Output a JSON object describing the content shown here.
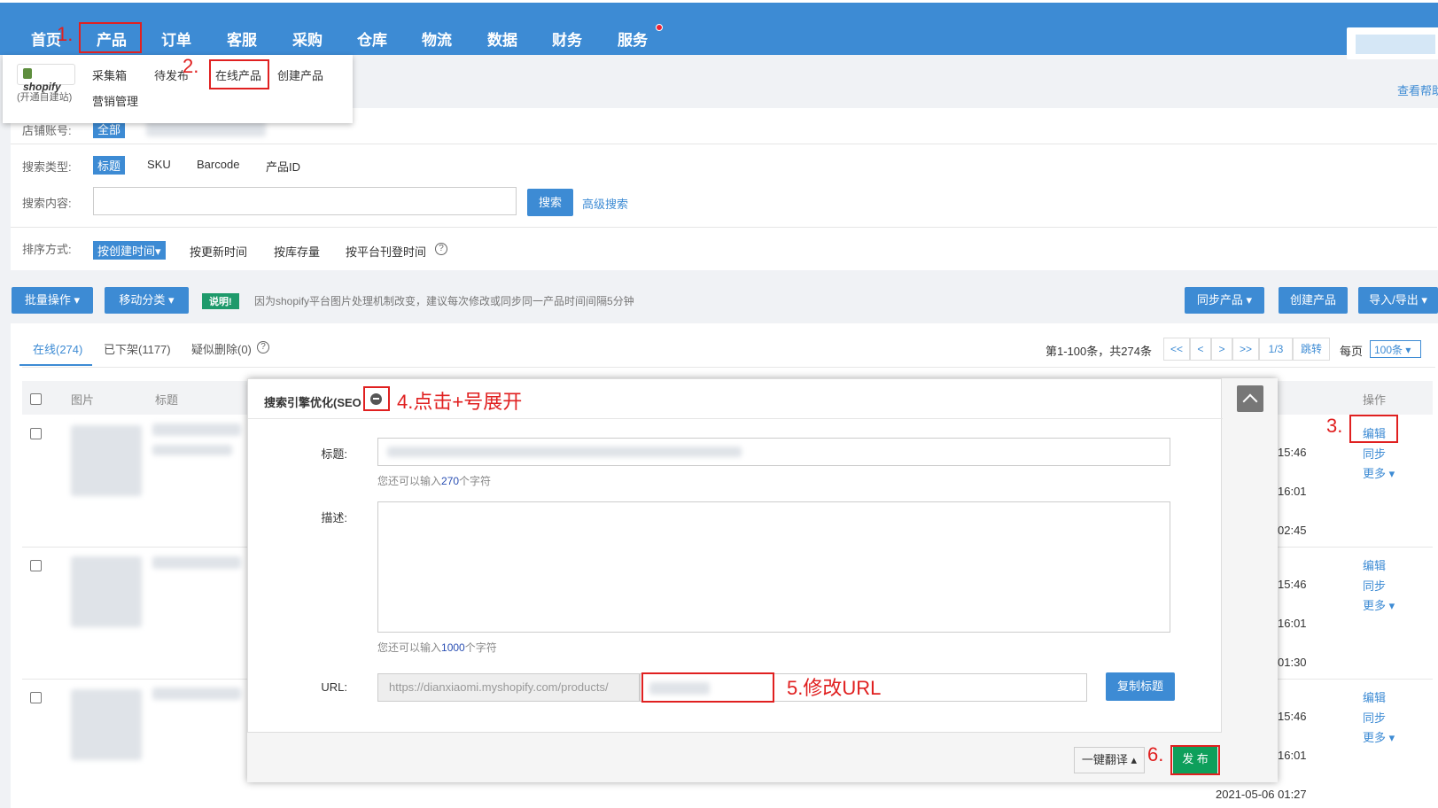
{
  "nav": {
    "items": [
      "首页",
      "产品",
      "订单",
      "客服",
      "采购",
      "仓库",
      "物流",
      "数据",
      "财务",
      "服务"
    ]
  },
  "dropdown": {
    "shopify_logo_text": "shopify",
    "shopify_sub": "(开通自建站)",
    "items": [
      "采集箱",
      "待发布",
      "在线产品",
      "创建产品",
      "营销管理"
    ]
  },
  "annotations": {
    "a1": "1.",
    "a2": "2.",
    "a3": "3.",
    "a4": "4.点击+号展开",
    "a5": "5.修改URL",
    "a6": "6."
  },
  "help_link": "查看帮助",
  "filters": {
    "shop_label": "店铺账号:",
    "shop_all": "全部",
    "search_type_label": "搜索类型:",
    "search_types": [
      "标题",
      "SKU",
      "Barcode",
      "产品ID"
    ],
    "search_content_label": "搜索内容:",
    "search_button": "搜索",
    "advanced_search": "高级搜索",
    "sort_label": "排序方式:",
    "sort_options": [
      "按创建时间▾",
      "按更新时间",
      "按库存量",
      "按平台刊登时间"
    ]
  },
  "toolbar": {
    "batch": "批量操作 ▾",
    "move_category": "移动分类 ▾",
    "notice_tag": "说明!",
    "notice_text": "因为shopify平台图片处理机制改变，建议每次修改或同步同一产品时间间隔5分钟",
    "sync_products": "同步产品 ▾",
    "create_product": "创建产品",
    "import_export": "导入/导出 ▾"
  },
  "tabs": [
    "在线(274)",
    "已下架(1177)",
    "疑似删除(0)"
  ],
  "pager": {
    "info": "第1-100条，共274条",
    "first": "<<",
    "prev": "<",
    "next": ">",
    "last": ">>",
    "page": "1/3",
    "jump": "跳转",
    "per_page_label": "每页",
    "per_page_value": "100条 ▾"
  },
  "table": {
    "headers": [
      "图片",
      "标题",
      "操作"
    ],
    "rows": [
      {
        "times": [
          "15:46",
          "16:01",
          "02:45"
        ],
        "ops": [
          "编辑",
          "同步",
          "更多 ▾"
        ]
      },
      {
        "times": [
          "15:46",
          "16:01",
          "01:30"
        ],
        "ops": [
          "编辑",
          "同步",
          "更多 ▾"
        ]
      },
      {
        "times": [
          "15:46",
          "16:01",
          "2021-05-06 01:27"
        ],
        "ops": [
          "编辑",
          "同步",
          "更多 ▾"
        ]
      }
    ]
  },
  "seo_modal": {
    "title": "搜索引擎优化(SEO",
    "title_label": "标题:",
    "title_value": "",
    "title_hint_prefix": "您还可以输入",
    "title_hint_num": "270",
    "title_hint_suffix": "个字符",
    "desc_label": "描述:",
    "desc_hint_prefix": "您还可以输入",
    "desc_hint_num": "1000",
    "desc_hint_suffix": "个字符",
    "url_label": "URL:",
    "url_prefix": "https://dianxiaomi.myshopify.com/products/",
    "copy_title": "复制标题",
    "translate": "一键翻译 ▴",
    "publish": "发 布"
  },
  "colors": {
    "primary": "#3d8bd4",
    "annotation": "#e02020",
    "publish": "#0e9f5b",
    "notice": "#1e9a6b"
  }
}
